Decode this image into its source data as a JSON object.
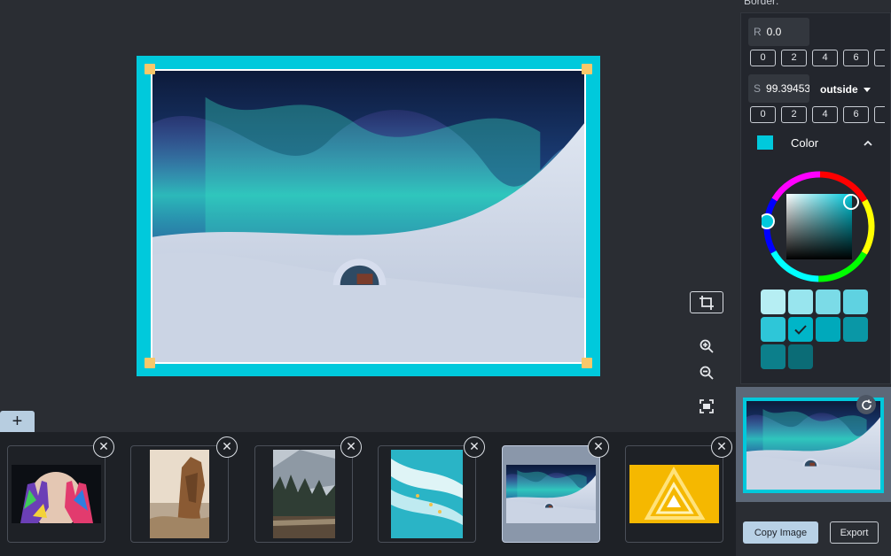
{
  "canvas": {
    "add_label": "+"
  },
  "panel": {
    "section_title": "Border:",
    "radius_field": {
      "label": "R",
      "value": "0.0"
    },
    "radius_presets": [
      "0",
      "2",
      "4",
      "6"
    ],
    "size_field": {
      "label": "S",
      "value": "99.39453"
    },
    "mode_select": {
      "value": "outside"
    },
    "size_presets": [
      "0",
      "2",
      "4",
      "6"
    ],
    "color": {
      "label": "Color",
      "current": "#00c9dc",
      "swatches": [
        "#b6eef3",
        "#98e5ee",
        "#7bdbe7",
        "#5fd2e1",
        "#2ec6d8",
        "#00b5c8",
        "#00a9bb",
        "#0a97a6",
        "#0c7f8b",
        "#0b6c76"
      ],
      "selected_swatch": 5
    }
  },
  "filmstrip": {
    "thumbnails": [
      {
        "name": "painted-hands"
      },
      {
        "name": "rock-formation"
      },
      {
        "name": "forest-lake"
      },
      {
        "name": "surfers-wave"
      },
      {
        "name": "aurora-ice-hotel",
        "selected": true
      },
      {
        "name": "yellow-triangle"
      }
    ],
    "close_glyph": "✕"
  },
  "actions": {
    "copy_label": "Copy Image",
    "export_label": "Export"
  },
  "colors": {
    "accent": "#00c9dc",
    "handle": "#f8c86a",
    "primary_button": "#b8d1e6"
  }
}
